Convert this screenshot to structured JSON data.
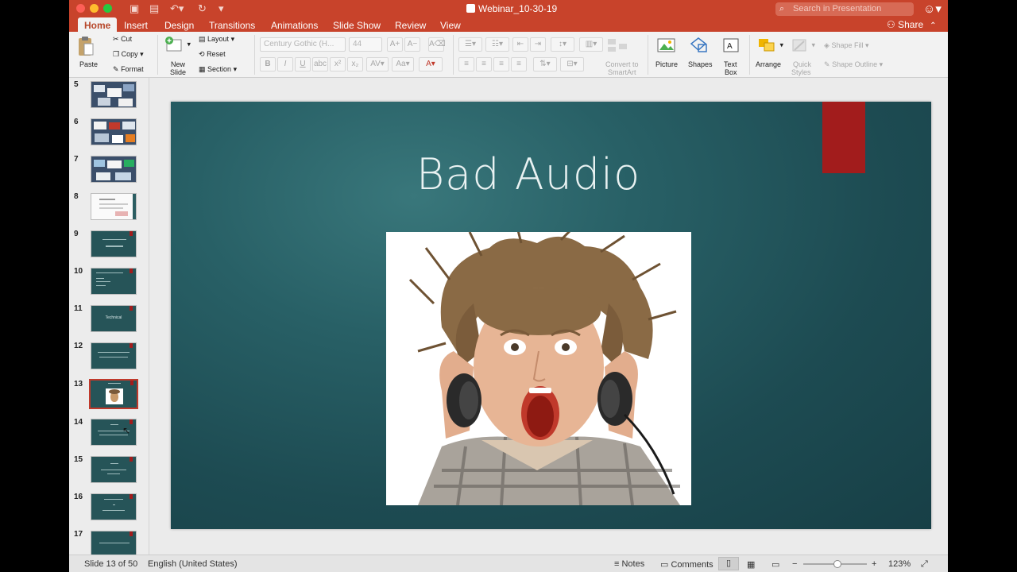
{
  "window": {
    "title": "Webinar_10-30-19",
    "search_placeholder": "Search in Presentation",
    "share_label": "Share"
  },
  "tabs": [
    "Home",
    "Insert",
    "Design",
    "Transitions",
    "Animations",
    "Slide Show",
    "Review",
    "View"
  ],
  "ribbon": {
    "paste": "Paste",
    "cut": "Cut",
    "copy": "Copy",
    "format": "Format",
    "new_slide_1": "New",
    "new_slide_2": "Slide",
    "layout": "Layout",
    "reset": "Reset",
    "section": "Section",
    "font_name": "Century Gothic (H...",
    "font_size": "44",
    "convert_smartart_1": "Convert to",
    "convert_smartart_2": "SmartArt",
    "picture": "Picture",
    "shapes": "Shapes",
    "text_box_1": "Text",
    "text_box_2": "Box",
    "arrange": "Arrange",
    "quick_styles_1": "Quick",
    "quick_styles_2": "Styles",
    "shape_fill": "Shape Fill",
    "shape_outline": "Shape Outline"
  },
  "thumbnails": [
    {
      "num": "5"
    },
    {
      "num": "6"
    },
    {
      "num": "7"
    },
    {
      "num": "8"
    },
    {
      "num": "9"
    },
    {
      "num": "10"
    },
    {
      "num": "11",
      "text": "Technical"
    },
    {
      "num": "12"
    },
    {
      "num": "13"
    },
    {
      "num": "14"
    },
    {
      "num": "15"
    },
    {
      "num": "16"
    },
    {
      "num": "17"
    }
  ],
  "slide": {
    "title": "Bad Audio"
  },
  "status": {
    "slide_counter": "Slide 13 of 50",
    "language": "English (United States)",
    "notes": "Notes",
    "comments": "Comments",
    "zoom": "123%"
  },
  "colors": {
    "accent": "#c8432b",
    "slide_bg": "#265458",
    "slide_tab": "#a21c1c"
  }
}
